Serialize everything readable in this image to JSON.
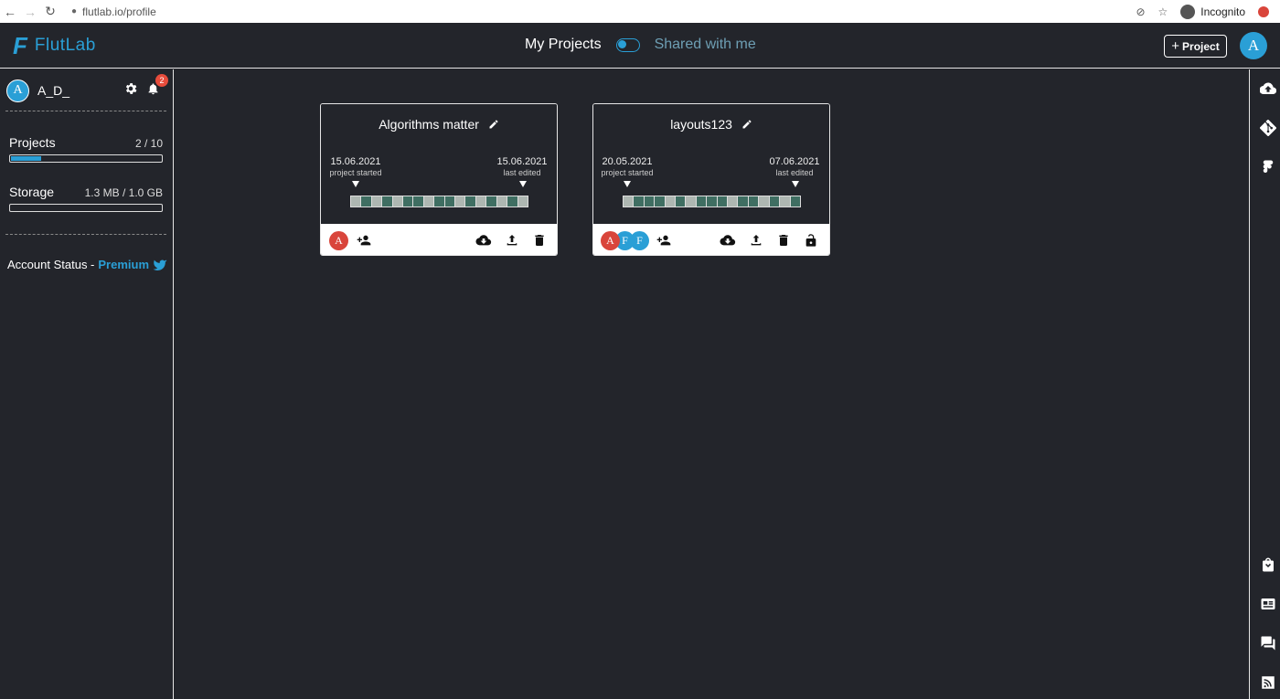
{
  "browser": {
    "url": "flutlab.io/profile",
    "mode_label": "Incognito"
  },
  "header": {
    "logo_mark": "F",
    "logo_text": "FlutLab",
    "tab_my_projects": "My Projects",
    "tab_shared": "Shared with me",
    "new_project_label": "Project",
    "avatar_letter": "A"
  },
  "sidebar": {
    "avatar_letter": "A",
    "username": "A_D_",
    "notification_count": "2",
    "projects_label": "Projects",
    "projects_value": "2 / 10",
    "projects_fraction": 0.2,
    "storage_label": "Storage",
    "storage_value": "1.3 MB / 1.0 GB",
    "storage_fraction": 0.0013,
    "account_status_label": "Account Status -",
    "account_status_value": "Premium"
  },
  "projects": [
    {
      "title": "Algorithms matter",
      "started_date": "15.06.2021",
      "started_label": "project started",
      "edited_date": "15.06.2021",
      "edited_label": "last edited",
      "members": [
        {
          "letter": "A",
          "color": "#d9453b"
        }
      ],
      "locked": false
    },
    {
      "title": "layouts123",
      "started_date": "20.05.2021",
      "started_label": "project started",
      "edited_date": "07.06.2021",
      "edited_label": "last edited",
      "members": [
        {
          "letter": "A",
          "color": "#d9453b"
        },
        {
          "letter": "F",
          "color": "#2a9fd6"
        },
        {
          "letter": "F",
          "color": "#2a9fd6"
        }
      ],
      "locked": true
    }
  ],
  "colors": {
    "accent": "#2a9fd6",
    "background": "#23252b",
    "badge": "#e74c3c"
  },
  "icons": {
    "right_sidebar": [
      "cloud-upload-icon",
      "git-icon",
      "figma-icon",
      "store-icon",
      "news-icon",
      "chat-icon",
      "rss-icon"
    ]
  }
}
